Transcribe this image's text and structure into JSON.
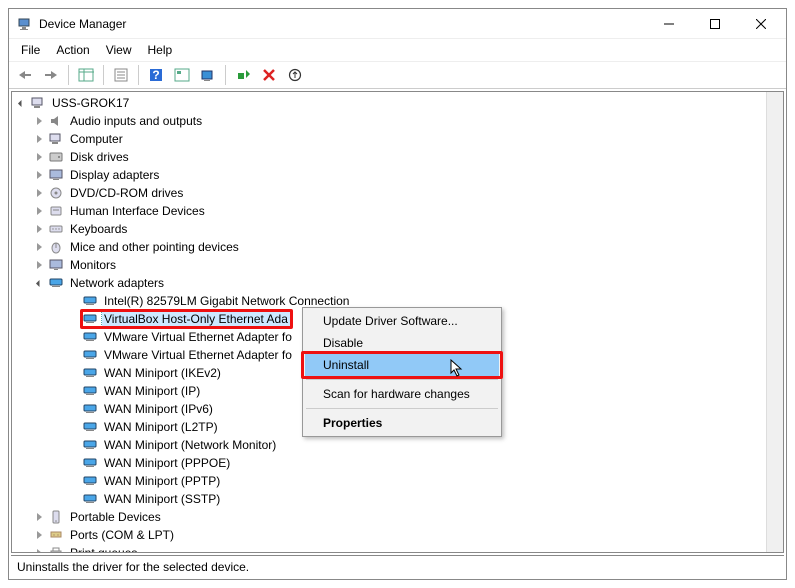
{
  "window": {
    "title": "Device Manager"
  },
  "menubar": [
    "File",
    "Action",
    "View",
    "Help"
  ],
  "root_node": "USS-GROK17",
  "categories": [
    "Audio inputs and outputs",
    "Computer",
    "Disk drives",
    "Display adapters",
    "DVD/CD-ROM drives",
    "Human Interface Devices",
    "Keyboards",
    "Mice and other pointing devices",
    "Monitors"
  ],
  "net_label": "Network adapters",
  "net_items": [
    "Intel(R) 82579LM Gigabit Network Connection",
    "VirtualBox Host-Only Ethernet Ada",
    "VMware Virtual Ethernet Adapter fo",
    "VMware Virtual Ethernet Adapter fo",
    "WAN Miniport (IKEv2)",
    "WAN Miniport (IP)",
    "WAN Miniport (IPv6)",
    "WAN Miniport (L2TP)",
    "WAN Miniport (Network Monitor)",
    "WAN Miniport (PPPOE)",
    "WAN Miniport (PPTP)",
    "WAN Miniport (SSTP)"
  ],
  "tail_categories": [
    "Portable Devices",
    "Ports (COM & LPT)",
    "Print queues"
  ],
  "context_menu": {
    "update": "Update Driver Software...",
    "disable": "Disable",
    "uninstall": "Uninstall",
    "scan": "Scan for hardware changes",
    "properties": "Properties"
  },
  "statusbar": "Uninstalls the driver for the selected device."
}
